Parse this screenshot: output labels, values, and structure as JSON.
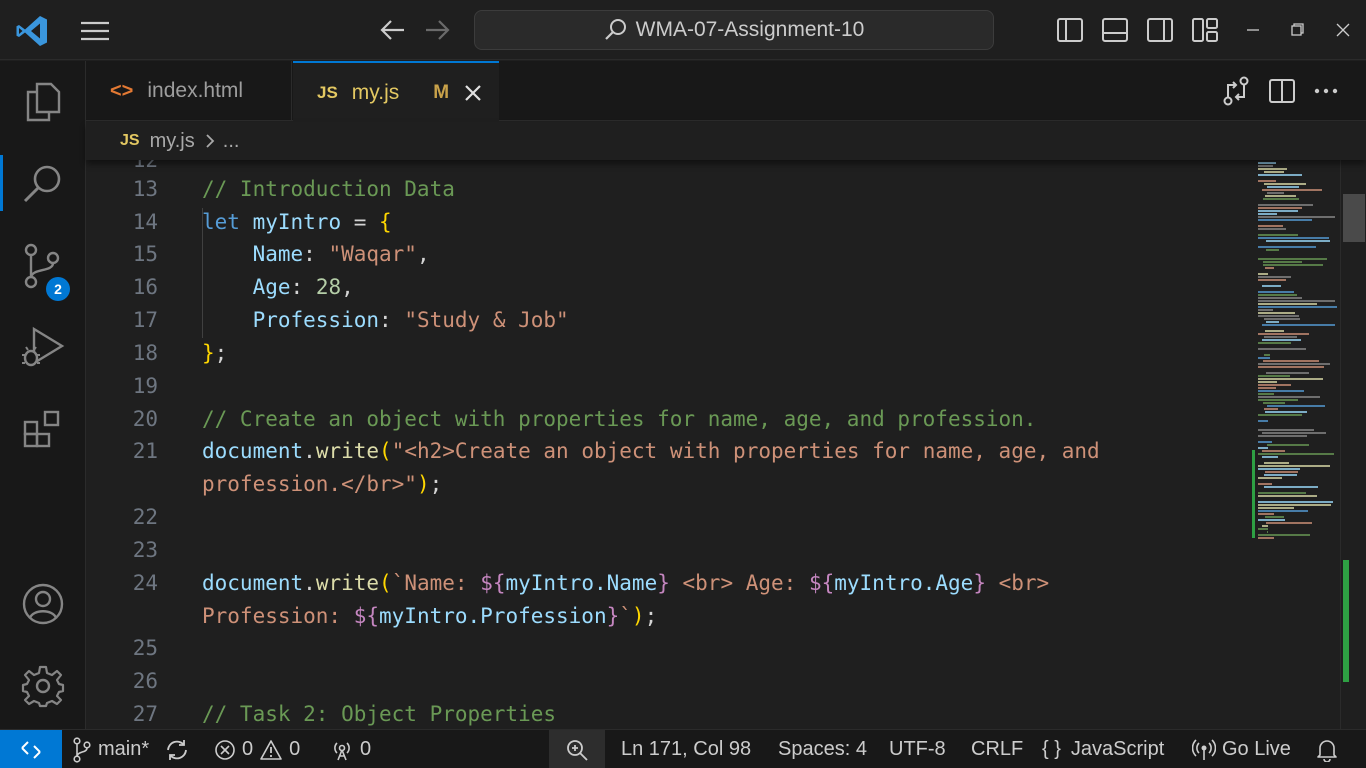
{
  "titlebar": {
    "search_text": "WMA-07-Assignment-10"
  },
  "activity_bar": {
    "scm_badge": "2"
  },
  "tabs": [
    {
      "icon": "<>",
      "label": "index.html"
    },
    {
      "icon": "JS",
      "label": "my.js",
      "status": "M"
    }
  ],
  "breadcrumb": {
    "icon": "JS",
    "file": "my.js",
    "more": "..."
  },
  "editor": {
    "partial_top_line": "12",
    "lines": [
      {
        "num": "13"
      },
      {
        "num": "14"
      },
      {
        "num": "15"
      },
      {
        "num": "16"
      },
      {
        "num": "17"
      },
      {
        "num": "18"
      },
      {
        "num": "19"
      },
      {
        "num": "20"
      },
      {
        "num": "21"
      },
      {
        "num": "22"
      },
      {
        "num": "23"
      },
      {
        "num": "24"
      },
      {
        "num": "25"
      },
      {
        "num": "26"
      },
      {
        "num": "27"
      }
    ],
    "code": {
      "l13": "// Introduction Data",
      "l14_kw": "let",
      "l14_var": "myIntro",
      "l14_eq": " = ",
      "l14_brace": "{",
      "l15_key": "Name",
      "l15_val": "\"Waqar\"",
      "l16_key": "Age",
      "l16_val": "28",
      "l17_key": "Profession",
      "l17_val": "\"Study & Job\"",
      "l18_brace": "}",
      "l20": "// Create an object with properties for name, age, and profession.",
      "l21_obj": "document",
      "l21_fn": "write",
      "l21_str_a": "\"<h2>Create an object with properties for name, age, and",
      "l21_str_b": "profession.</br>\"",
      "l24_obj": "document",
      "l24_fn": "write",
      "l24_t1": "`Name: ",
      "l24_e1": "myIntro.Name",
      "l24_t2": " <br> Age: ",
      "l24_e2": "myIntro.Age",
      "l24_t3": " <br>",
      "l24_t4": "Profession: ",
      "l24_e3": "myIntro.Profession",
      "l24_t5": "`",
      "l27": "// Task 2: Object Properties"
    }
  },
  "statusbar": {
    "branch": "main*",
    "errors": "0",
    "warnings": "0",
    "ports": "0",
    "position": "Ln 171, Col 98",
    "spaces": "Spaces: 4",
    "encoding": "UTF-8",
    "eol": "CRLF",
    "language": "JavaScript",
    "language_icon": "{ }",
    "golive": "Go Live"
  },
  "colors": {
    "accent": "#0078d4",
    "comment": "#6a9955",
    "keyword": "#569cd6",
    "variable": "#9cdcfe",
    "string": "#ce9178",
    "function": "#dcdcaa",
    "git_added": "#2ea043"
  },
  "icons": [
    "vscode-logo-icon",
    "hamburger-menu-icon",
    "arrow-left-icon",
    "arrow-right-icon",
    "search-icon",
    "toggle-primary-sidebar-icon",
    "toggle-panel-icon",
    "toggle-secondary-sidebar-icon",
    "customize-layout-icon",
    "minimize-icon",
    "restore-icon",
    "close-icon",
    "explorer-icon",
    "search-icon",
    "source-control-icon",
    "run-debug-icon",
    "extensions-icon",
    "account-icon",
    "settings-gear-icon",
    "compare-changes-icon",
    "split-editor-icon",
    "more-actions-icon",
    "remote-icon",
    "branch-icon",
    "sync-icon",
    "error-icon",
    "warning-icon",
    "broadcast-icon",
    "zoom-icon",
    "bell-icon"
  ]
}
